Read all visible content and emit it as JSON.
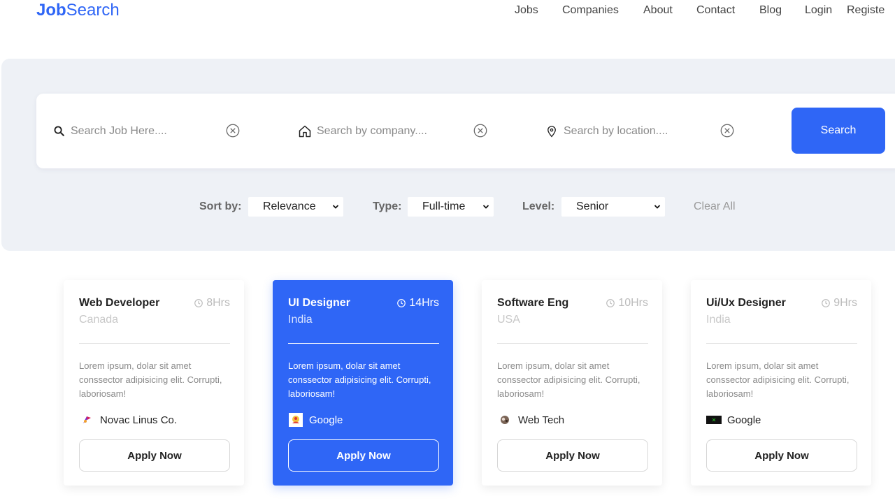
{
  "brand": {
    "part1": "Job",
    "part2": "Search"
  },
  "nav": [
    "Jobs",
    "Companies",
    "About",
    "Contact",
    "Blog",
    "Login",
    "Registe"
  ],
  "search": {
    "job_placeholder": "Search Job Here....",
    "company_placeholder": "Search by company....",
    "location_placeholder": "Search by location....",
    "button_label": "Search"
  },
  "filters": {
    "sort_label": "Sort by:",
    "sort_value": "Relevance",
    "type_label": "Type:",
    "type_value": "Full-time",
    "level_label": "Level:",
    "level_value": "Senior",
    "clear_label": "Clear All"
  },
  "cards": [
    {
      "title": "Web Developer",
      "time": "8Hrs",
      "country": "Canada",
      "desc": "Lorem ipsum, dolar sit amet conssector adipisicing elit. Corrupti, laboriosam!",
      "company": "Novac Linus Co.",
      "apply": "Apply Now"
    },
    {
      "title": "UI Designer",
      "time": "14Hrs",
      "country": "India",
      "desc": "Lorem ipsum, dolar sit amet conssector adipisicing elit. Corrupti, laboriosam!",
      "company": "Google",
      "apply": "Apply Now"
    },
    {
      "title": "Software Eng",
      "time": "10Hrs",
      "country": "USA",
      "desc": "Lorem ipsum, dolar sit amet conssector adipisicing elit. Corrupti, laboriosam!",
      "company": "Web Tech",
      "apply": "Apply Now"
    },
    {
      "title": "Ui/Ux Designer",
      "time": "9Hrs",
      "country": "India",
      "desc": "Lorem ipsum, dolar sit amet conssector adipisicing elit. Corrupti, laboriosam!",
      "company": "Google",
      "apply": "Apply Now"
    }
  ],
  "colors": {
    "accent": "#2f66f6",
    "panel": "#eef1f6"
  },
  "icons": {
    "job_field": "search-icon",
    "company_field": "home-icon",
    "location_field": "location-pin-icon",
    "clear": "close-circle-icon",
    "time": "clock-icon",
    "select": "chevron-down-icon"
  }
}
